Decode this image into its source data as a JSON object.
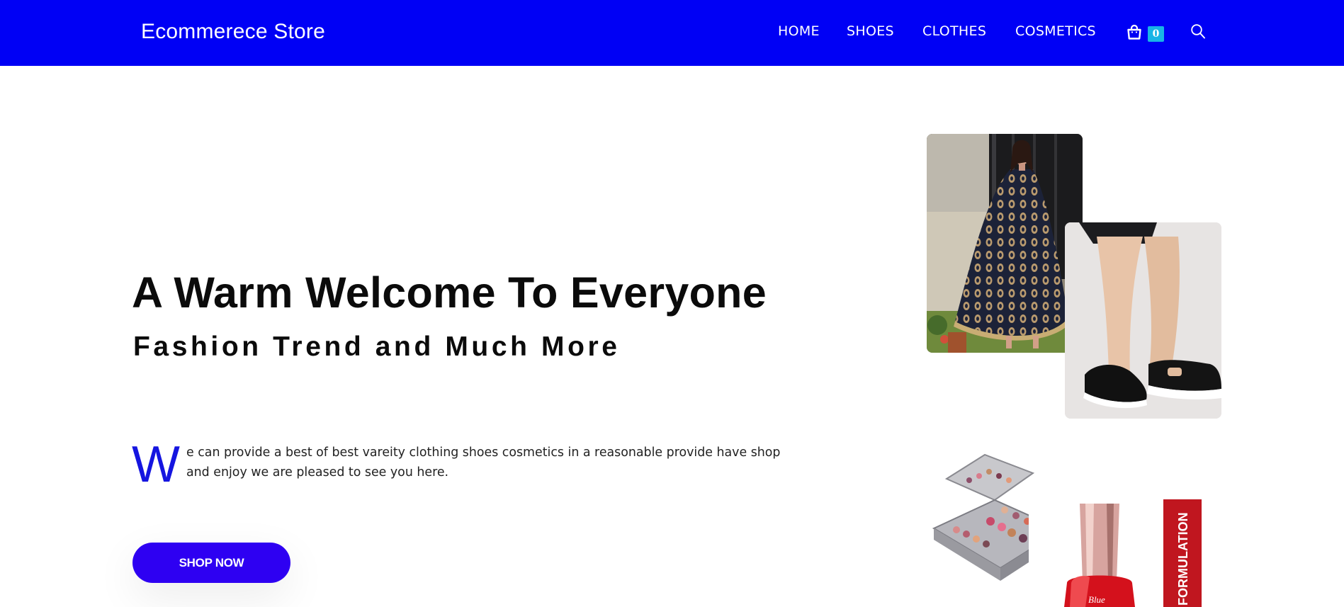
{
  "header": {
    "logo": "Ecommerece Store",
    "nav": [
      "HOME",
      "SHOES",
      "CLOTHES",
      "COSMETICS"
    ],
    "cart_count": "0",
    "icons": {
      "cart": "shopping-bag-icon",
      "search": "search-icon"
    },
    "colors": {
      "background": "#0000f5",
      "badge": "#18b4e6"
    }
  },
  "hero": {
    "title": "A Warm Welcome To Everyone",
    "subtitle": "Fashion Trend and Much More",
    "dropcap": "W",
    "description": "e can provide a best of best vareity clothing shoes cosmetics in a reasonable provide have shop and enjoy we are pleased to see you here.",
    "button": "SHOP NOW",
    "colors": {
      "dropcap": "#1515e0",
      "button": "#2e00f2"
    }
  },
  "gallery": {
    "polish_label": "FORMULATION",
    "polish_brand": "Blue"
  }
}
